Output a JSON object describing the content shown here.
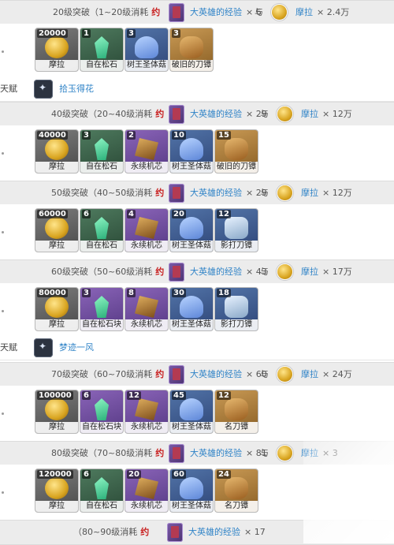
{
  "item_names": {
    "mora": "摩拉",
    "free_stone": "自在松石",
    "free_stone_chunk": "自在松石块",
    "tree_mushroom": "树王圣体菇",
    "broken_guard": "破旧的刀镡",
    "eternal_core": "永续机芯",
    "shadow_guard": "影打刀镡",
    "famous_guard": "名刀镡"
  },
  "common": {
    "yue": "约",
    "exp_item": "大英雄的经验",
    "yu": "与",
    "mora": "摩拉"
  },
  "rows": [
    {
      "header": {
        "label": "20级突破（1~20级消耗",
        "exp_count": "× 6",
        "mora_amount": "× 2.4万"
      },
      "items": [
        {
          "count": "20000",
          "name": "摩拉",
          "icon": "mora-coin"
        },
        {
          "count": "1",
          "name": "自在松石",
          "icon": "free-stone"
        },
        {
          "count": "3",
          "name": "树王圣体菇",
          "icon": "tree-mushroom"
        },
        {
          "count": "3",
          "name": "破旧的刀镡",
          "icon": "broken-guard"
        }
      ]
    },
    {
      "header": {
        "label": "40级突破（20~40级消耗",
        "exp_count": "× 29",
        "mora_amount": "× 12万"
      },
      "items": [
        {
          "count": "40000",
          "name": "摩拉",
          "icon": "mora-coin"
        },
        {
          "count": "3",
          "name": "自在松石",
          "icon": "free-stone"
        },
        {
          "count": "2",
          "name": "永续机芯",
          "icon": "eternal-core"
        },
        {
          "count": "10",
          "name": "树王圣体菇",
          "icon": "tree-mushroom"
        },
        {
          "count": "15",
          "name": "破旧的刀镡",
          "icon": "broken-guard"
        }
      ]
    },
    {
      "header": {
        "label": "50级突破（40~50级消耗",
        "exp_count": "× 29",
        "mora_amount": "× 12万"
      },
      "items": [
        {
          "count": "60000",
          "name": "摩拉",
          "icon": "mora-coin"
        },
        {
          "count": "6",
          "name": "自在松石",
          "icon": "free-stone"
        },
        {
          "count": "4",
          "name": "永续机芯",
          "icon": "eternal-core"
        },
        {
          "count": "20",
          "name": "树王圣体菇",
          "icon": "tree-mushroom"
        },
        {
          "count": "12",
          "name": "影打刀镡",
          "icon": "shadow-guard"
        }
      ]
    },
    {
      "header": {
        "label": "60级突破（50~60级消耗",
        "exp_count": "× 43",
        "mora_amount": "× 17万"
      },
      "items": [
        {
          "count": "80000",
          "name": "摩拉",
          "icon": "mora-coin"
        },
        {
          "count": "3",
          "name": "自在松石块",
          "icon": "free-stone-chunk"
        },
        {
          "count": "8",
          "name": "永续机芯",
          "icon": "eternal-core"
        },
        {
          "count": "30",
          "name": "树王圣体菇",
          "icon": "tree-mushroom"
        },
        {
          "count": "18",
          "name": "影打刀镡",
          "icon": "shadow-guard"
        }
      ]
    },
    {
      "header": {
        "label": "70级突破（60~70级消耗",
        "exp_count": "× 60",
        "mora_amount": "× 24万"
      },
      "items": [
        {
          "count": "100000",
          "name": "摩拉",
          "icon": "mora-coin"
        },
        {
          "count": "6",
          "name": "自在松石块",
          "icon": "free-stone-chunk"
        },
        {
          "count": "12",
          "name": "永续机芯",
          "icon": "eternal-core"
        },
        {
          "count": "45",
          "name": "树王圣体菇",
          "icon": "tree-mushroom"
        },
        {
          "count": "12",
          "name": "名刀镡",
          "icon": "famous-guard"
        }
      ]
    },
    {
      "header": {
        "label": "80级突破（70~80级消耗",
        "exp_count": "× 81",
        "mora_amount": "× 3"
      },
      "items": [
        {
          "count": "120000",
          "name": "摩拉",
          "icon": "mora-coin"
        },
        {
          "count": "6",
          "name": "自在松石",
          "icon": "free-stone"
        },
        {
          "count": "20",
          "name": "永续机芯",
          "icon": "eternal-core"
        },
        {
          "count": "60",
          "name": "树王圣体菇",
          "icon": "tree-mushroom"
        },
        {
          "count": "24",
          "name": "名刀镡",
          "icon": "famous-guard"
        }
      ]
    },
    {
      "header": {
        "label": "（80~90级消耗",
        "exp_count": "× 17",
        "mora_amount": ""
      },
      "items": []
    }
  ],
  "talents": [
    {
      "label": "天赋",
      "name": "拾玉得花",
      "icon": "talent-icon"
    },
    {
      "label": "天赋",
      "name": "梦迹一风",
      "icon": "talent-icon"
    }
  ]
}
